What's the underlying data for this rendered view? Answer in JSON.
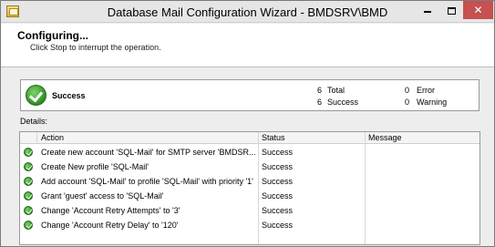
{
  "window": {
    "title": "Database Mail Configuration Wizard - BMDSRV\\BMD",
    "minimize_icon": "minimize-icon",
    "maximize_icon": "maximize-icon",
    "close_glyph": "✕"
  },
  "header": {
    "title": "Configuring...",
    "subtitle": "Click Stop to interrupt the operation."
  },
  "summary": {
    "status": "Success",
    "total_count": "6",
    "total_label": "Total",
    "success_count": "6",
    "success_label": "Success",
    "error_count": "0",
    "error_label": "Error",
    "warning_count": "0",
    "warning_label": "Warning"
  },
  "details": {
    "label": "Details:",
    "columns": {
      "action": "Action",
      "status": "Status",
      "message": "Message"
    },
    "rows": [
      {
        "action": "Create new account 'SQL-Mail' for SMTP server 'BMDSR...",
        "status": "Success",
        "message": ""
      },
      {
        "action": "Create New profile 'SQL-Mail'",
        "status": "Success",
        "message": ""
      },
      {
        "action": "Add account 'SQL-Mail' to profile 'SQL-Mail' with priority '1'",
        "status": "Success",
        "message": ""
      },
      {
        "action": "Grant 'guest' access to 'SQL-Mail'",
        "status": "Success",
        "message": ""
      },
      {
        "action": "Change 'Account Retry Attempts' to '3'",
        "status": "Success",
        "message": ""
      },
      {
        "action": "Change 'Account Retry Delay' to '120'",
        "status": "Success",
        "message": ""
      }
    ]
  },
  "colors": {
    "close_button": "#c75050",
    "success_green": "#2f8f23"
  }
}
